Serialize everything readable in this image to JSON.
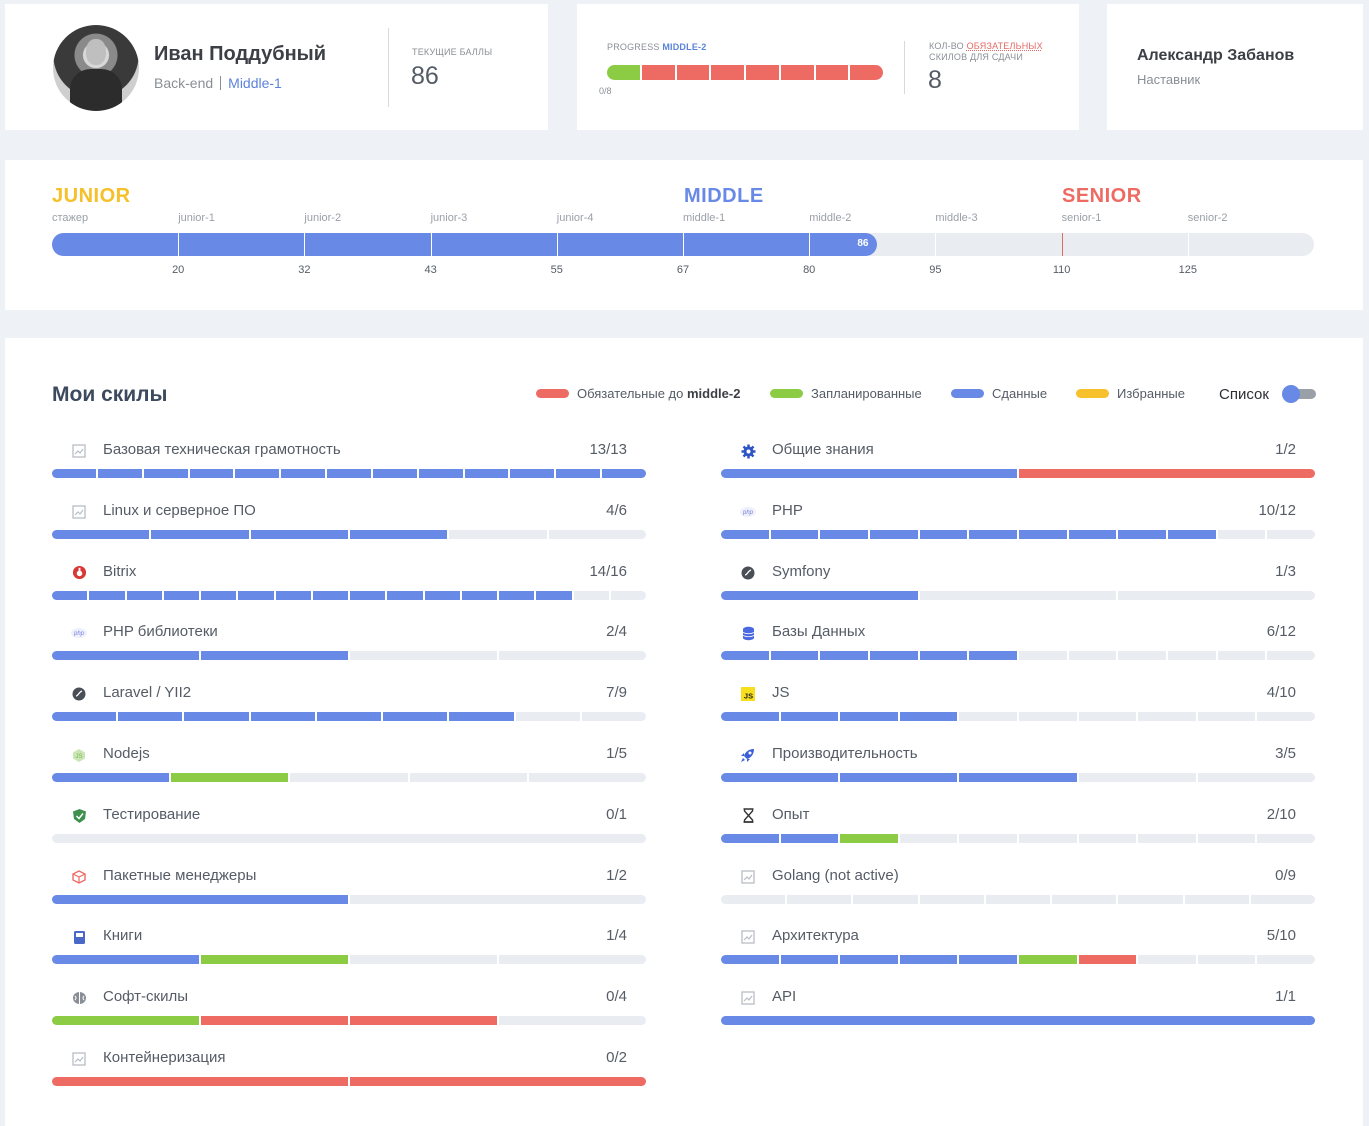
{
  "colors": {
    "done": "#6889e6",
    "required": "#ee6b64",
    "planned": "#8ccc45",
    "favorite": "#f7c12d",
    "empty": "#e9ecf1"
  },
  "profile": {
    "name": "Иван Поддубный",
    "role": "Back-end",
    "level": "Middle-1",
    "score_caption": "ТЕКУЩИЕ БАЛЛЫ",
    "score": "86"
  },
  "progress": {
    "caption_prefix": "PROGRESS",
    "caption_level": "MIDDLE-2",
    "count_label": "0/8",
    "segments": [
      "planned",
      "required",
      "required",
      "required",
      "required",
      "required",
      "required",
      "required"
    ],
    "required_caption_1": "КОЛ-ВО",
    "required_caption_2": "ОБЯЗАТЕЛЬНЫХ",
    "required_caption_3": "СКИЛОВ ДЛЯ СДАЧИ",
    "required_count": "8"
  },
  "mentor": {
    "name": "Александр Забанов",
    "role": "Наставник"
  },
  "levels": {
    "titles": {
      "junior": "JUNIOR",
      "middle": "MIDDLE",
      "senior": "SENIOR"
    },
    "sublevels": [
      "стажер",
      "junior-1",
      "junior-2",
      "junior-3",
      "junior-4",
      "middle-1",
      "middle-2",
      "middle-3",
      "senior-1",
      "senior-2"
    ],
    "thresholds": [
      "20",
      "32",
      "43",
      "55",
      "67",
      "80",
      "95",
      "110",
      "125"
    ],
    "current_score": "86",
    "fill_percent": 65.4
  },
  "skills": {
    "title": "Мои скилы",
    "legend": {
      "required_prefix": "Обязательные до",
      "required_level": "middle-2",
      "planned": "Запланированные",
      "done": "Сданные",
      "favorite": "Избранные"
    },
    "list_label": "Список",
    "left": [
      {
        "name": "Базовая техническая грамотность",
        "count": "13/13",
        "icon": "placeholder-icon",
        "segs": "ddddddddddddd"
      },
      {
        "name": "Linux и серверное ПО",
        "count": "4/6",
        "icon": "placeholder-icon",
        "segs": "dddd__"
      },
      {
        "name": "Bitrix",
        "count": "14/16",
        "icon": "bitrix-icon",
        "segs": "dddddddddddddd__"
      },
      {
        "name": "PHP библиотеки",
        "count": "2/4",
        "icon": "php-icon",
        "segs": "dd__"
      },
      {
        "name": "Laravel / YII2",
        "count": "7/9",
        "icon": "symfony-icon",
        "segs": "ddddddd__"
      },
      {
        "name": "Nodejs",
        "count": "1/5",
        "icon": "nodejs-icon",
        "segs": "dp___"
      },
      {
        "name": "Тестирование",
        "count": "0/1",
        "icon": "shield-icon",
        "segs": "_"
      },
      {
        "name": "Пакетные менеджеры",
        "count": "1/2",
        "icon": "package-icon",
        "segs": "d_"
      },
      {
        "name": "Книги",
        "count": "1/4",
        "icon": "book-icon",
        "segs": "dp__"
      },
      {
        "name": "Софт-скилы",
        "count": "0/4",
        "icon": "brain-icon",
        "segs": "prr_"
      },
      {
        "name": "Контейнеризация",
        "count": "0/2",
        "icon": "placeholder-icon",
        "segs": "rr"
      }
    ],
    "right": [
      {
        "name": "Общие знания",
        "count": "1/2",
        "icon": "gear-icon",
        "segs": "dr"
      },
      {
        "name": "PHP",
        "count": "10/12",
        "icon": "php-icon",
        "segs": "dddddddddd__"
      },
      {
        "name": "Symfony",
        "count": "1/3",
        "icon": "symfony-icon",
        "segs": "d__"
      },
      {
        "name": "Базы Данных",
        "count": "6/12",
        "icon": "database-icon",
        "segs": "dddddd______"
      },
      {
        "name": "JS",
        "count": "4/10",
        "icon": "js-icon",
        "segs": "dddd______"
      },
      {
        "name": "Производительность",
        "count": "3/5",
        "icon": "rocket-icon",
        "segs": "ddd__"
      },
      {
        "name": "Опыт",
        "count": "2/10",
        "icon": "hourglass-icon",
        "segs": "ddp_______"
      },
      {
        "name": "Golang (not active)",
        "count": "0/9",
        "icon": "placeholder-icon",
        "segs": "_________"
      },
      {
        "name": "Архитектура",
        "count": "5/10",
        "icon": "placeholder-icon",
        "segs": "dddddpr___"
      },
      {
        "name": "API",
        "count": "1/1",
        "icon": "placeholder-icon",
        "segs": "d"
      }
    ]
  }
}
